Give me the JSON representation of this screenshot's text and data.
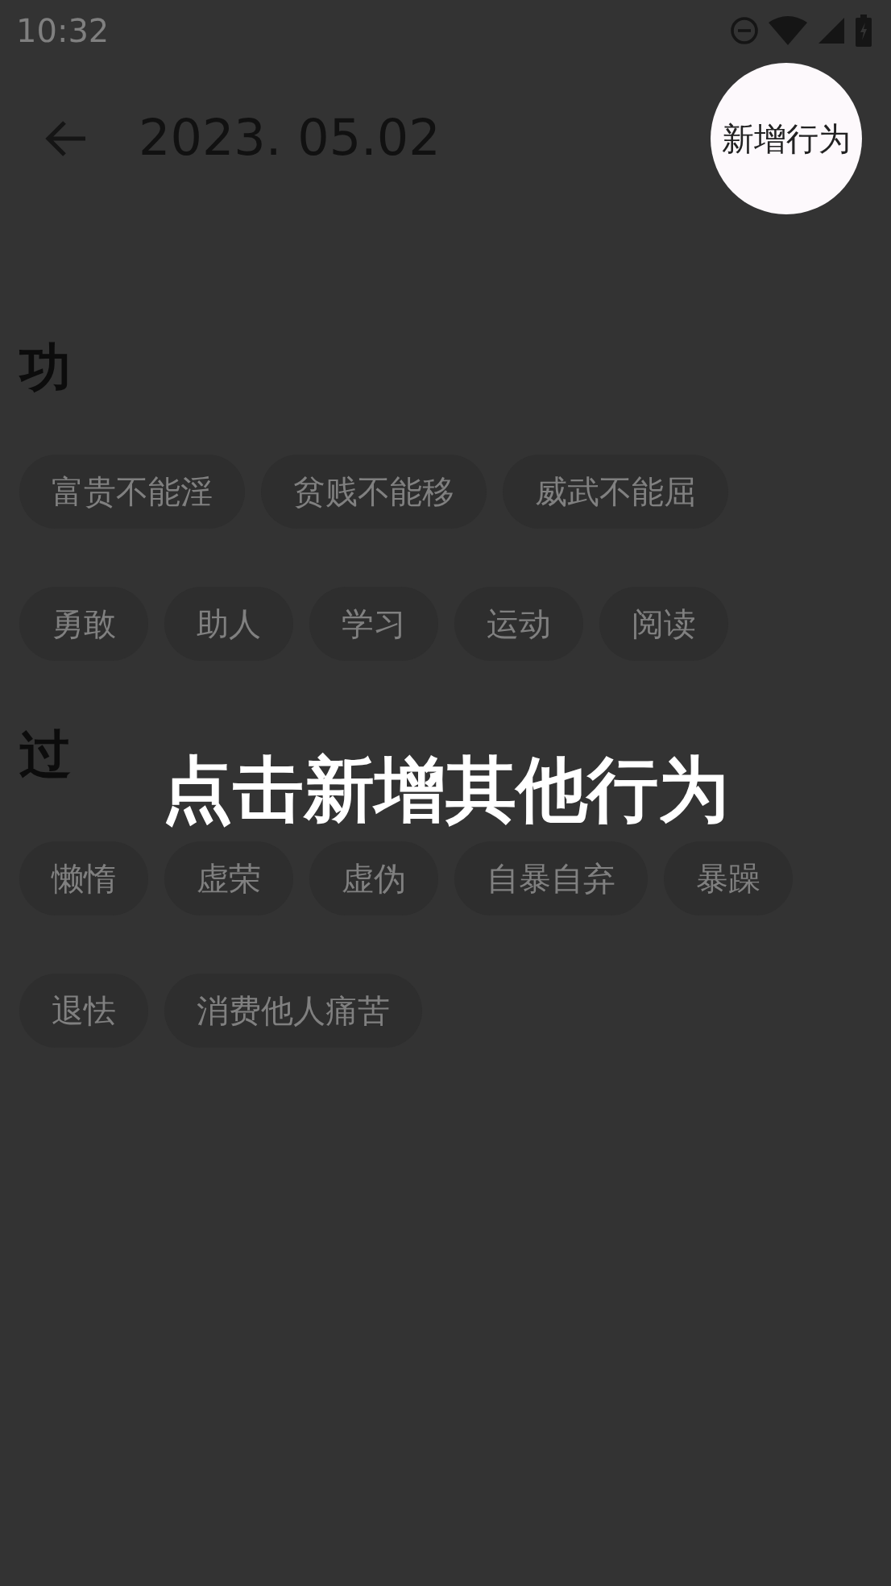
{
  "status_bar": {
    "time": "10:32"
  },
  "app_bar": {
    "title": "2023. 05.02",
    "action": "新增行为"
  },
  "sections": [
    {
      "title": "功",
      "chips": [
        "富贵不能淫",
        "贫贱不能移",
        "威武不能屈",
        "勇敢",
        "助人",
        "学习",
        "运动",
        "阅读"
      ]
    },
    {
      "title": "过",
      "chips": [
        "懒惰",
        "虚荣",
        "虚伪",
        "自暴自弃",
        "暴躁",
        "退怯",
        "消费他人痛苦"
      ]
    }
  ],
  "hint": "点击新增其他行为"
}
